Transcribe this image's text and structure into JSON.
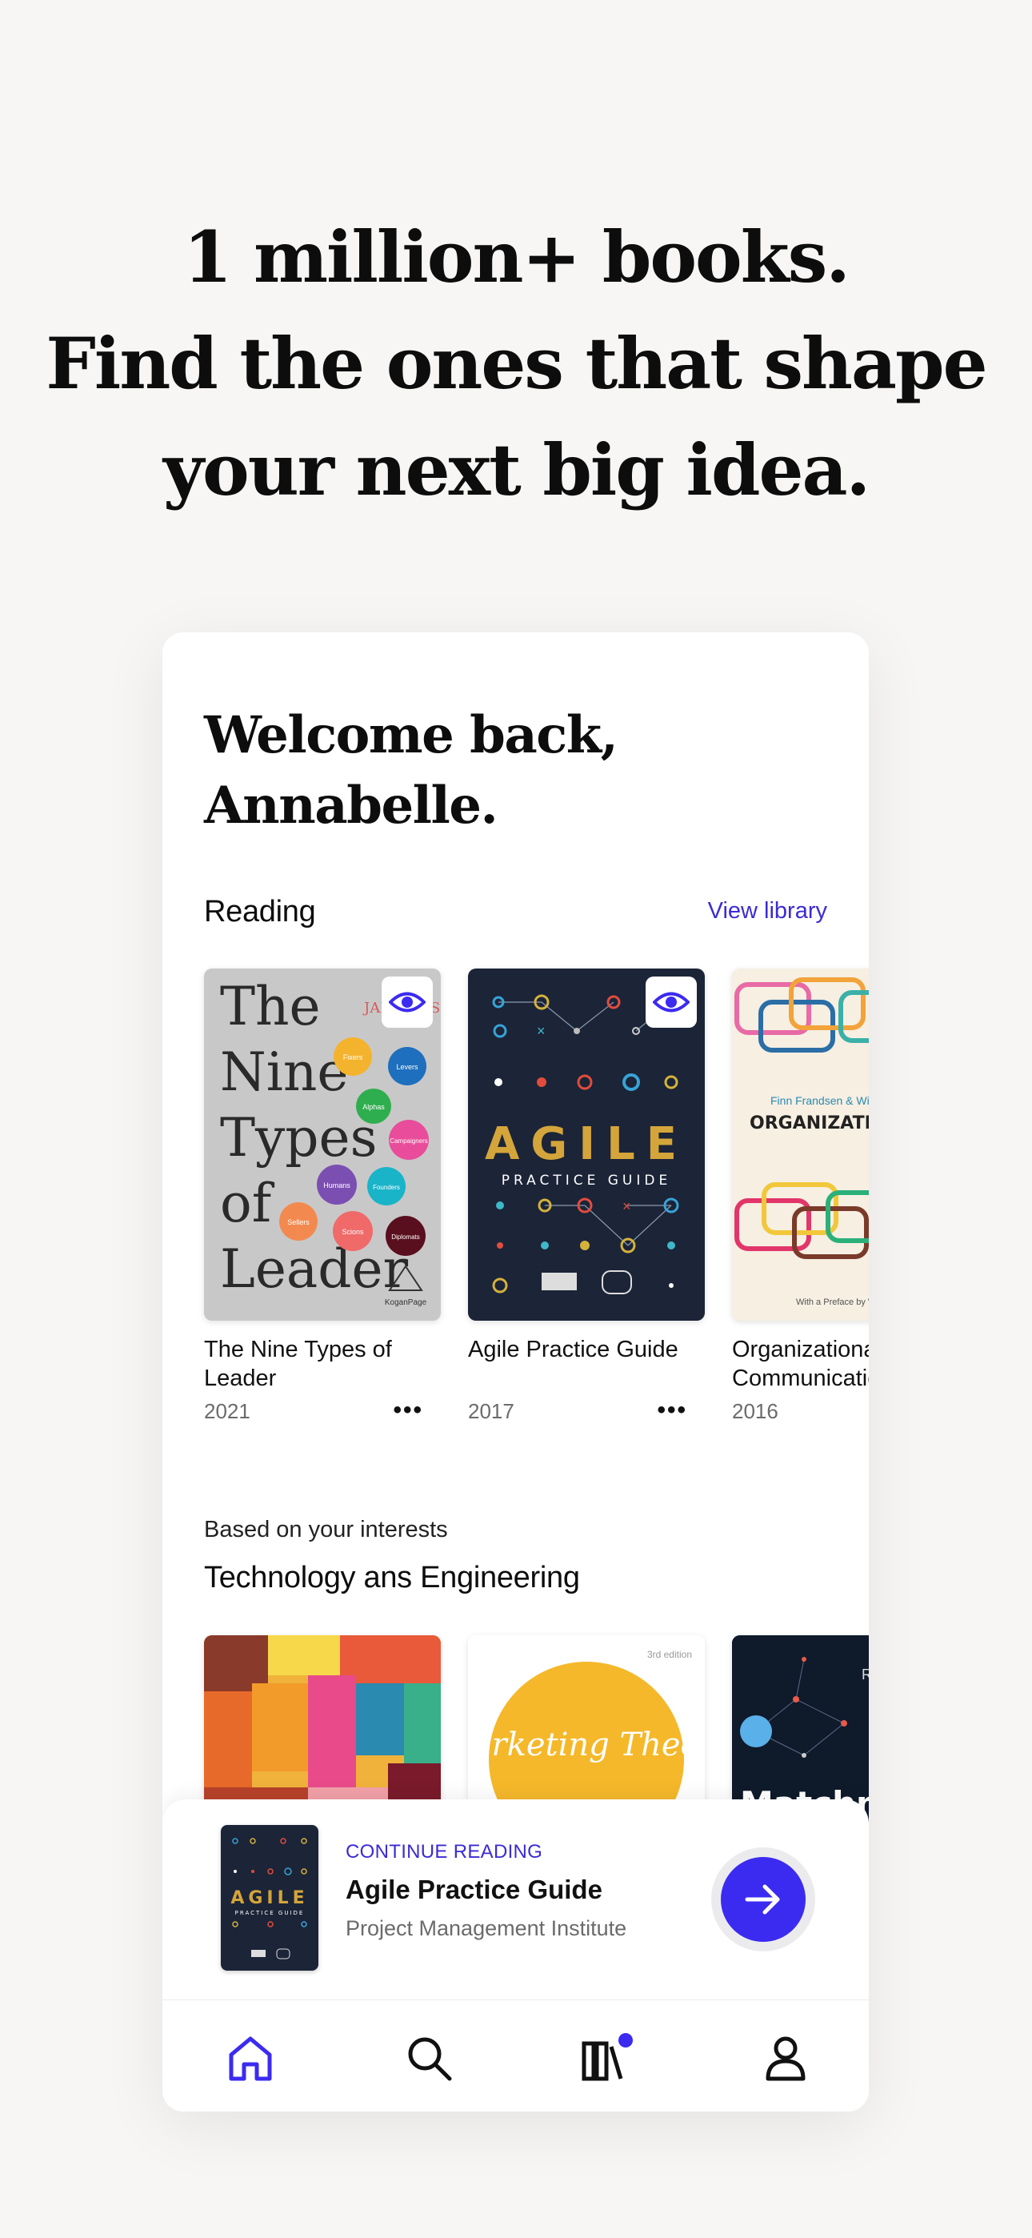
{
  "headline": {
    "line1": "1 million+ books.",
    "line2": "Find the ones that shape",
    "line3": "your next big idea."
  },
  "home": {
    "welcome_line1": "Welcome back,",
    "welcome_line2": "Annabelle.",
    "reading_title": "Reading",
    "view_library": "View library",
    "reading_books": [
      {
        "title": "The Nine Types of Leader",
        "year": "2021",
        "cover_lines": [
          "The",
          "Nine",
          "Types",
          "of",
          "Leader"
        ],
        "cover_author": "JAMES ASHTON",
        "cover_bubbles": [
          "Fixers",
          "Levers",
          "Alphas",
          "Campaigners",
          "Humans",
          "Founders",
          "Sellers",
          "Scions",
          "Diplomats"
        ],
        "cover_publisher": "KoganPage",
        "more": "•••"
      },
      {
        "title": "Agile Practice Guide",
        "year": "2017",
        "cover_main": "AGILE",
        "cover_sub": "PRACTICE GUIDE",
        "more": "•••"
      },
      {
        "title": "Organizational Crisis Communication",
        "year": "2016",
        "cover_author": "Finn Frandsen & Winni Johansen",
        "cover_main": "ORGANIZATIONAL CRISIS COMMUNICATION",
        "cover_footer": "With a Preface by W. Timothy Coombs"
      }
    ],
    "interest_subtitle": "Based on your interests",
    "interest_title": "Technology ans Engineering",
    "interest_books": [
      {
        "cover_text": ""
      },
      {
        "cover_edition": "3rd edition",
        "cover_text": "Marketing Theory"
      },
      {
        "cover_text": "Matchm",
        "cover_corner": "R"
      }
    ]
  },
  "continue_reading": {
    "label": "CONTINUE READING",
    "title": "Agile Practice Guide",
    "author": "Project Management Institute",
    "mini_cover_main": "AGILE",
    "mini_cover_sub": "PRACTICE GUIDE"
  },
  "nav": {
    "items": [
      "home-icon",
      "search-icon",
      "library-icon",
      "profile-icon"
    ],
    "active": "home-icon"
  },
  "colors": {
    "accent": "#3b2bf0",
    "background": "#f7f6f4"
  }
}
